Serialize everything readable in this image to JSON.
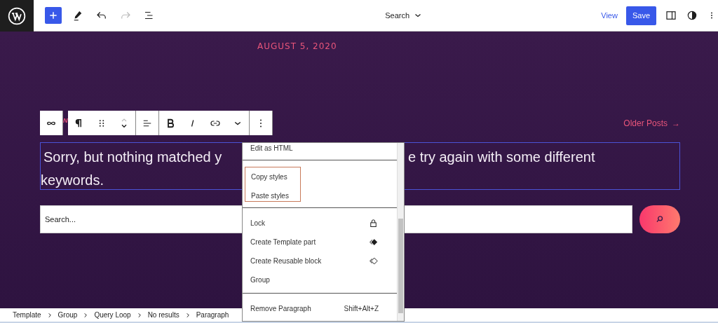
{
  "top_bar": {
    "history": [
      {
        "kind": "undo",
        "disabled": false
      },
      {
        "kind": "redo",
        "disabled": true
      }
    ],
    "title": "Search",
    "view_link": "View",
    "save_button": "Save"
  },
  "content": {
    "date": "AUGUST 5, 2020",
    "fragment": "N",
    "older_posts": "Older Posts",
    "older_arrow": "→"
  },
  "paragraph": {
    "visible_parts": [
      "Sorry, but nothing matched y",
      "e try again with some different"
    ],
    "line_2": "keywords."
  },
  "search": {
    "placeholder": "Search..."
  },
  "menu": {
    "sections": [
      {
        "highlighted": false,
        "items": [
          {
            "kind": "plain",
            "label": "Edit as HTML"
          }
        ]
      },
      {
        "highlighted": true,
        "items": [
          {
            "kind": "plain",
            "label": "Copy styles"
          },
          {
            "kind": "plain",
            "label": "Paste styles"
          }
        ]
      },
      {
        "highlighted": false,
        "items": [
          {
            "kind": "lock",
            "label": "Lock"
          },
          {
            "kind": "template",
            "label": "Create Template part"
          },
          {
            "kind": "reusable",
            "label": "Create Reusable block"
          },
          {
            "kind": "plain",
            "label": "Group"
          }
        ]
      },
      {
        "highlighted": false,
        "items": [
          {
            "kind": "shortcut",
            "label": "Remove Paragraph",
            "shortcut": "Shift+Alt+Z"
          }
        ]
      }
    ]
  },
  "breadcrumb": [
    "Template",
    "Group",
    "Query Loop",
    "No results",
    "Paragraph"
  ]
}
